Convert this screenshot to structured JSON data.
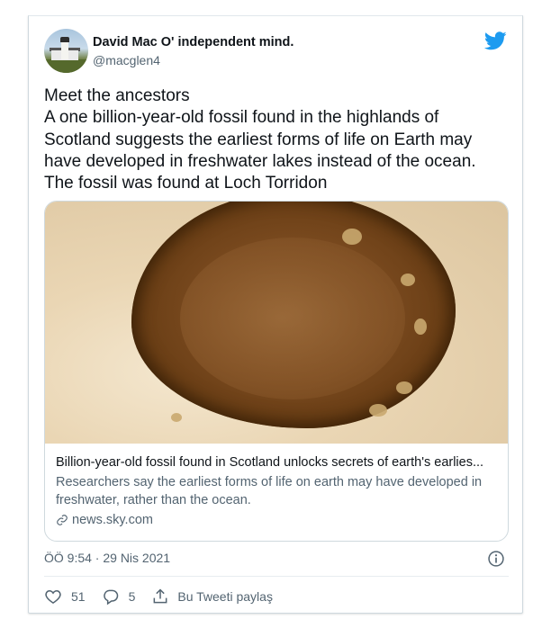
{
  "author": {
    "name": "David Mac O' independent mind.",
    "handle": "@macglen4"
  },
  "tweet": {
    "lines": [
      "Meet the ancestors",
      "A one billion-year-old fossil found in the highlands of",
      "Scotland suggests the earliest forms of life on Earth may",
      "have developed in freshwater lakes instead of the ocean.",
      "The fossil was found at Loch Torridon"
    ]
  },
  "link_card": {
    "title": "Billion-year-old fossil found in Scotland unlocks secrets of earth's earlies...",
    "description_lines": [
      "Researchers say the earliest forms of life on earth may have developed in",
      "freshwater, rather than the ocean."
    ],
    "domain": "news.sky.com"
  },
  "meta": {
    "timestamp": "ÖÖ 9:54 · 29 Nis 2021"
  },
  "actions": {
    "likes": "51",
    "replies": "5",
    "share_label": "Bu Tweeti paylaş"
  },
  "colors": {
    "twitter_blue": "#1d9bf0",
    "secondary_text": "#536471",
    "primary_text": "#0f1419"
  },
  "icons": {
    "logo": "twitter-bird-icon",
    "info": "info-icon",
    "link": "link-icon",
    "like": "heart-icon",
    "reply": "reply-bubble-icon",
    "share": "share-icon"
  }
}
